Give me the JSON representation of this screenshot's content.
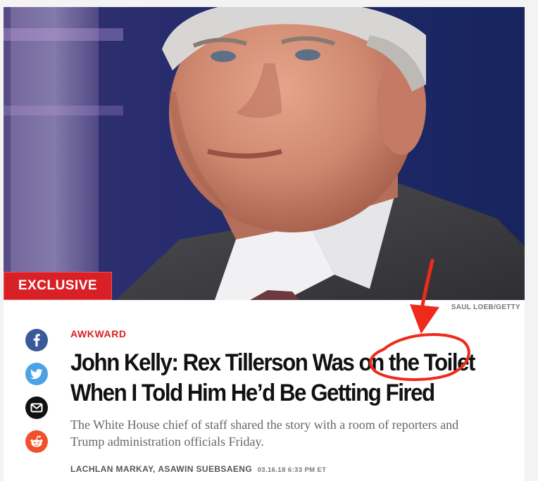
{
  "hero": {
    "badge_label": "EXCLUSIVE",
    "photo_credit": "SAUL LOEB/GETTY"
  },
  "share": {
    "facebook_icon": "facebook-icon",
    "twitter_icon": "twitter-icon",
    "email_icon": "email-icon",
    "reddit_icon": "reddit-icon"
  },
  "article": {
    "kicker": "AWKWARD",
    "headline": "John Kelly: Rex Tillerson Was on the Toilet When I Told Him He’d Be Getting Fired",
    "dek": "The White House chief of staff shared the story with a room of reporters and Trump administration officials Friday.",
    "authors": [
      "LACHLAN MARKAY,",
      "ASAWIN SUEBSAENG"
    ],
    "timestamp": "03.16.18 6:33 PM ET"
  },
  "colors": {
    "accent_red": "#d92027",
    "annotation_red": "#ee2a1c",
    "facebook": "#3b5998",
    "twitter": "#4ba3e5",
    "reddit": "#f0512b"
  }
}
